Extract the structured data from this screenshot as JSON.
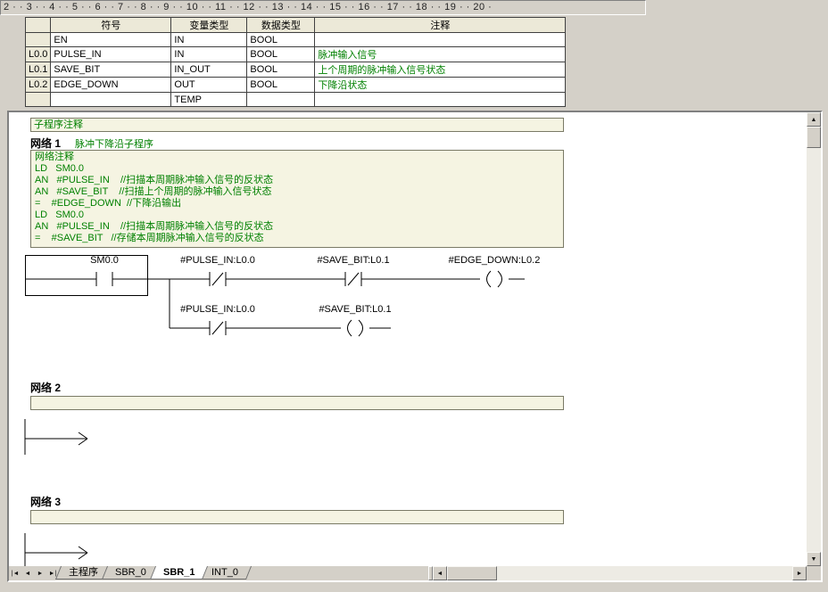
{
  "ruler": {
    "text": "2 · · 3 · · 4 · · 5 · · 6 · · 7 · · 8 · · 9 · · 10 · · 11 · · 12 · · 13 · · 14 · · 15 · · 16 · · 17 · · 18 · · 19 · · 20 ·"
  },
  "var_table": {
    "headers": {
      "symbol": "符号",
      "var_type": "变量类型",
      "data_type": "数据类型",
      "comment": "注释"
    },
    "rows": [
      {
        "addr": "",
        "symbol": "EN",
        "var_type": "IN",
        "data_type": "BOOL",
        "comment": ""
      },
      {
        "addr": "L0.0",
        "symbol": "PULSE_IN",
        "var_type": "IN",
        "data_type": "BOOL",
        "comment": "脉冲输入信号"
      },
      {
        "addr": "L0.1",
        "symbol": "SAVE_BIT",
        "var_type": "IN_OUT",
        "data_type": "BOOL",
        "comment": "上个周期的脉冲输入信号状态"
      },
      {
        "addr": "L0.2",
        "symbol": "EDGE_DOWN",
        "var_type": "OUT",
        "data_type": "BOOL",
        "comment": "下降沿状态"
      },
      {
        "addr": "",
        "symbol": "",
        "var_type": "TEMP",
        "data_type": "",
        "comment": ""
      }
    ]
  },
  "editor": {
    "subroutine_comment": "子程序注释",
    "network1": {
      "label": "网络 1",
      "title": "脉冲下降沿子程序",
      "comment": "网络注释\nLD   SM0.0\nAN   #PULSE_IN    //扫描本周期脉冲输入信号的反状态\nAN   #SAVE_BIT    //扫描上个周期的脉冲输入信号状态\n=    #EDGE_DOWN  //下降沿输出\nLD   SM0.0\nAN   #PULSE_IN    //扫描本周期脉冲输入信号的反状态\n=    #SAVE_BIT   //存储本周期脉冲输入信号的反状态",
      "ladder": {
        "rung1": {
          "contact1": "SM0.0",
          "contact2": "#PULSE_IN:L0.0",
          "contact3": "#SAVE_BIT:L0.1",
          "coil": "#EDGE_DOWN:L0.2"
        },
        "rung2": {
          "contact1": "#PULSE_IN:L0.0",
          "coil": "#SAVE_BIT:L0.1"
        }
      }
    },
    "network2": {
      "label": "网络 2"
    },
    "network3": {
      "label": "网络 3"
    }
  },
  "tab_bar": {
    "nav_first": "|◄",
    "nav_prev": "◄",
    "nav_next": "►",
    "nav_last": "►|",
    "tabs": [
      "主程序",
      "SBR_0",
      "SBR_1",
      "INT_0"
    ],
    "active_tab": "SBR_1"
  },
  "scrollbars": {
    "up": "▲",
    "down": "▼",
    "left": "◄",
    "right": "►"
  },
  "colors": {
    "comment_green": "#008000",
    "panel_beige": "#f5f4e2",
    "header_beige": "#ece9d8",
    "window_gray": "#d4d0c8"
  }
}
